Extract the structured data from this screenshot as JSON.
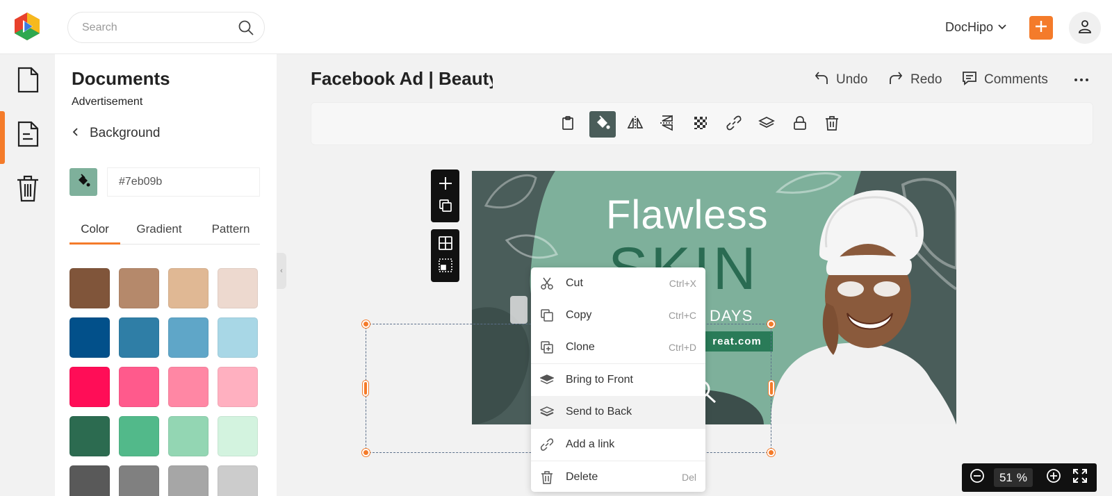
{
  "header": {
    "search_placeholder": "Search",
    "brand_menu_label": "DocHipo",
    "accent_color": "#f47b2a"
  },
  "rail": {
    "items": [
      {
        "name": "document-icon"
      },
      {
        "name": "document-list-icon",
        "active": true
      },
      {
        "name": "trash-icon"
      }
    ]
  },
  "panel": {
    "title": "Documents",
    "subtitle": "Advertisement",
    "back_label": "Background",
    "current_color": "#7eb09b",
    "hex_value": "#7eb09b",
    "tabs": [
      {
        "label": "Color",
        "active": true
      },
      {
        "label": "Gradient",
        "active": false
      },
      {
        "label": "Pattern",
        "active": false
      }
    ],
    "swatches": [
      [
        "#80553a",
        "#b5896b",
        "#e0b894",
        "#edd9cf"
      ],
      [
        "#02508a",
        "#2f7ea6",
        "#5fa6c8",
        "#a8d7e6"
      ],
      [
        "#ff0d57",
        "#ff5a8c",
        "#ff87a4",
        "#ffb0c0"
      ],
      [
        "#2c6b50",
        "#52b98a",
        "#93d6b3",
        "#d3f3df"
      ],
      [
        "#595959",
        "#808080",
        "#a6a6a6",
        "#cccccc"
      ]
    ]
  },
  "document": {
    "title": "Facebook Ad | Beauty Promotion",
    "undo_label": "Undo",
    "redo_label": "Redo",
    "comments_label": "Comments"
  },
  "toolbar": {
    "tools": [
      "clipboard-icon",
      "paint-bucket-icon",
      "flip-horizontal-icon",
      "flip-vertical-icon",
      "transparency-icon",
      "link-icon",
      "layers-icon",
      "lock-icon",
      "trash-icon"
    ],
    "active_tool": "paint-bucket-icon",
    "active_color": "#4a5d5a"
  },
  "ad": {
    "headline": "Flawless",
    "skin": "SKIN",
    "days": "DAYS",
    "url": "reat.com",
    "dark_bg": "#4a5d5a",
    "mint": "#7eb09b",
    "green": "#2a6b52"
  },
  "context_menu": {
    "items": [
      {
        "label": "Cut",
        "shortcut": "Ctrl+X",
        "icon": "scissors-icon"
      },
      {
        "label": "Copy",
        "shortcut": "Ctrl+C",
        "icon": "copy-icon"
      },
      {
        "label": "Clone",
        "shortcut": "Ctrl+D",
        "icon": "clone-icon"
      },
      {
        "label": "Bring to Front",
        "shortcut": "",
        "icon": "bring-front-icon"
      },
      {
        "label": "Send to Back",
        "shortcut": "",
        "icon": "send-back-icon",
        "highlighted": true
      },
      {
        "label": "Add a link",
        "shortcut": "",
        "icon": "link-icon"
      },
      {
        "label": "Delete",
        "shortcut": "Del",
        "icon": "trash-icon"
      }
    ]
  },
  "zoom": {
    "value": "51",
    "unit": "%"
  }
}
